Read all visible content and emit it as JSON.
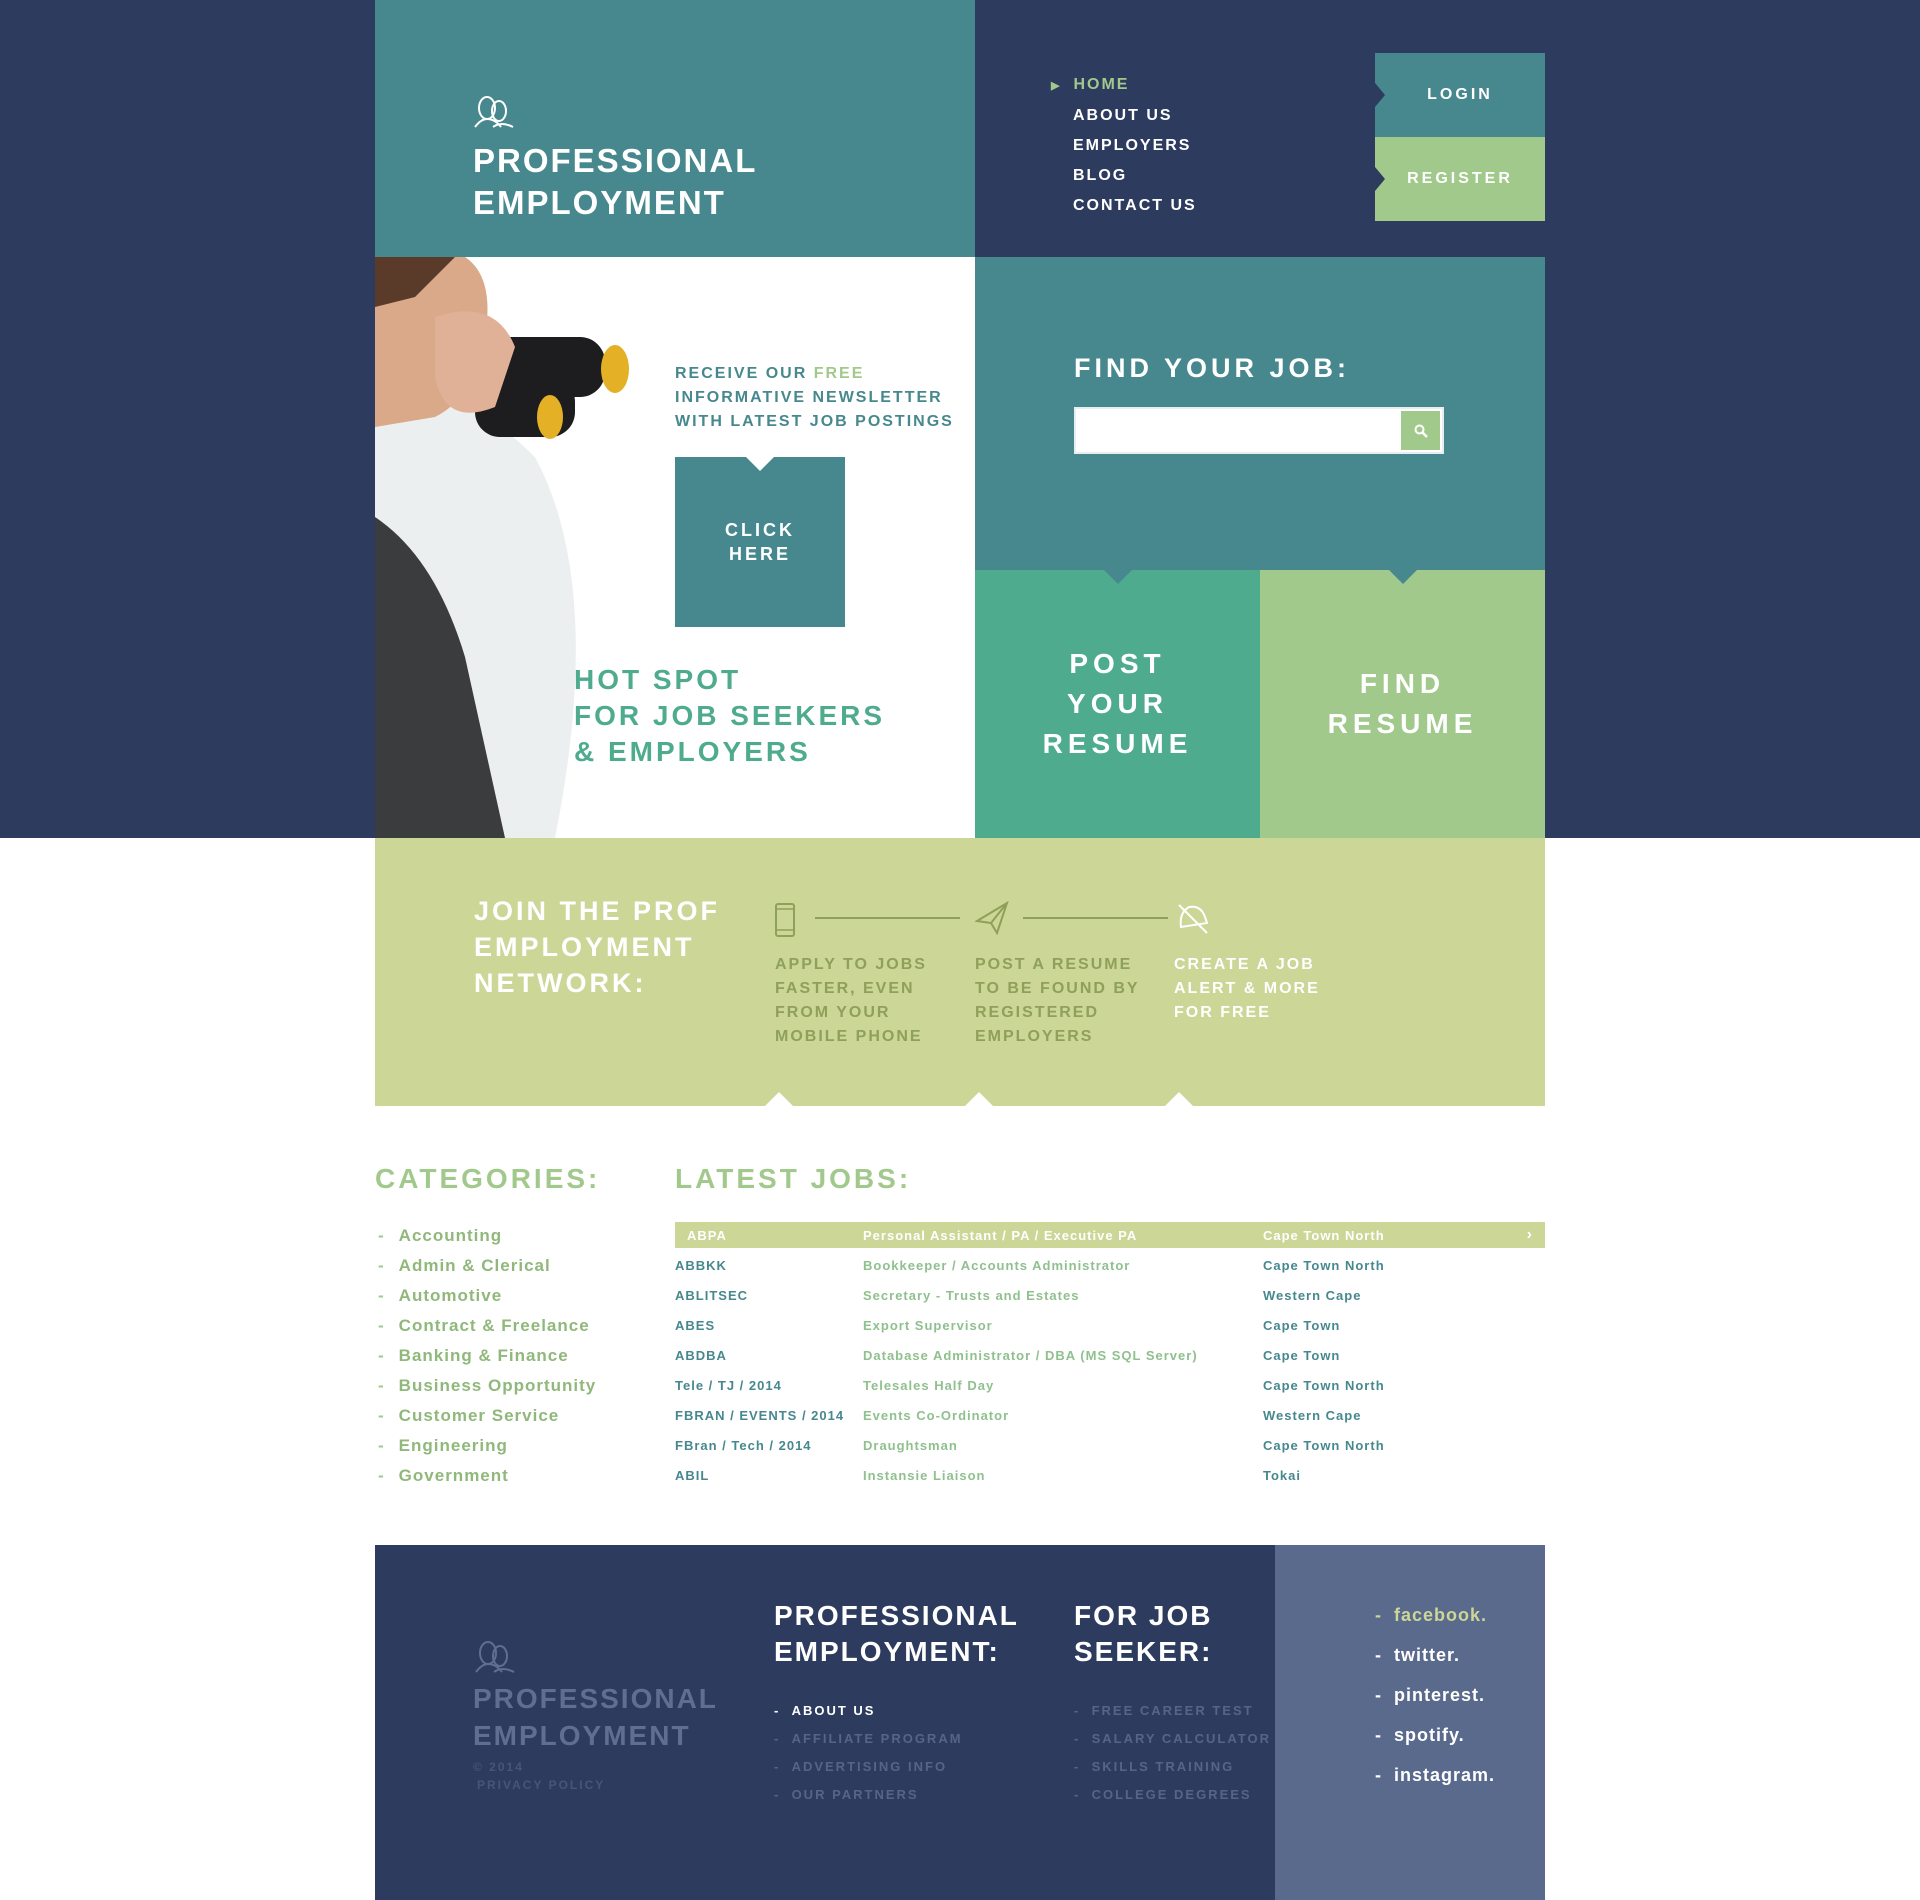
{
  "colors": {
    "navy": "#2d3b5e",
    "teal": "#46888e",
    "green": "#4fab8e",
    "light_green": "#a2c98c",
    "lime": "#cbd697",
    "slate": "#5a6a8c"
  },
  "brand": {
    "line1": "PROFESSIONAL",
    "line2": "EMPLOYMENT",
    "icon": "people-icon"
  },
  "nav": {
    "items": [
      "HOME",
      "ABOUT US",
      "EMPLOYERS",
      "BLOG",
      "CONTACT US"
    ],
    "active": "HOME"
  },
  "auth": {
    "login": "LOGIN",
    "register": "REGISTER"
  },
  "hero": {
    "news1a": "RECEIVE OUR ",
    "news1b": "FREE",
    "news2": "INFORMATIVE NEWSLETTER",
    "news3": "WITH LATEST JOB POSTINGS",
    "cta1": "CLICK",
    "cta2": "HERE",
    "hot1": "HOT SPOT",
    "hot2": "FOR JOB SEEKERS",
    "hot3": "& EMPLOYERS"
  },
  "search": {
    "title": "FIND YOUR JOB:",
    "value": "",
    "placeholder": "",
    "icon": "search-icon"
  },
  "tiles": {
    "post": [
      "POST",
      "YOUR",
      "RESUME"
    ],
    "find": [
      "FIND",
      "RESUME"
    ]
  },
  "join": {
    "title": [
      "JOIN THE PROF",
      "EMPLOYMENT",
      "NETWORK:"
    ],
    "steps": [
      {
        "icon": "mobile-phone-icon",
        "lines": [
          "APPLY TO JOBS",
          "FASTER, EVEN",
          "FROM YOUR",
          "MOBILE PHONE"
        ]
      },
      {
        "icon": "paper-plane-icon",
        "lines": [
          "POST A RESUME",
          "TO BE FOUND BY",
          "REGISTERED",
          "EMPLOYERS"
        ]
      },
      {
        "icon": "bell-icon",
        "lines": [
          "CREATE A JOB",
          "ALERT & MORE",
          "FOR FREE"
        ]
      }
    ]
  },
  "categories": {
    "title": "CATEGORIES:",
    "items": [
      "Accounting",
      "Admin & Clerical",
      "Automotive",
      "Contract & Freelance",
      "Banking & Finance",
      "Business Opportunity",
      "Customer Service",
      "Engineering",
      "Government"
    ]
  },
  "jobs": {
    "title": "LATEST JOBS:",
    "rows": [
      [
        "ABPA",
        "Personal Assistant / PA / Executive PA",
        "Cape Town North"
      ],
      [
        "ABBKK",
        "Bookkeeper / Accounts Administrator",
        "Cape Town North"
      ],
      [
        "ABLITSEC",
        "Secretary - Trusts and Estates",
        "Western Cape"
      ],
      [
        "ABES",
        "Export Supervisor",
        "Cape Town"
      ],
      [
        "ABDBA",
        "Database Administrator / DBA (MS SQL Server)",
        "Cape Town"
      ],
      [
        "Tele / TJ / 2014",
        "Telesales Half Day",
        "Cape Town North"
      ],
      [
        "FBRAN / EVENTS / 2014",
        "Events Co-Ordinator",
        "Western Cape"
      ],
      [
        "FBran / Tech / 2014",
        "Draughtsman",
        "Cape Town North"
      ],
      [
        "ABIL",
        "Instansie Liaison",
        "Tokai"
      ]
    ]
  },
  "footer": {
    "brand1": "PROFESSIONAL",
    "brand2": "EMPLOYMENT",
    "copyright": "© 2014",
    "privacy": "PRIVACY POLICY",
    "col1": {
      "title1": "PROFESSIONAL",
      "title2": "EMPLOYMENT:",
      "links": [
        "ABOUT US",
        "AFFILIATE PROGRAM",
        "ADVERTISING INFO",
        "OUR PARTNERS"
      ]
    },
    "col2": {
      "title1": "FOR JOB",
      "title2": "SEEKER:",
      "links": [
        "FREE CAREER TEST",
        "SALARY CALCULATOR",
        "SKILLS TRAINING",
        "COLLEGE DEGREES"
      ]
    },
    "social": [
      "facebook.",
      "twitter.",
      "pinterest.",
      "spotify.",
      "instagram."
    ]
  }
}
